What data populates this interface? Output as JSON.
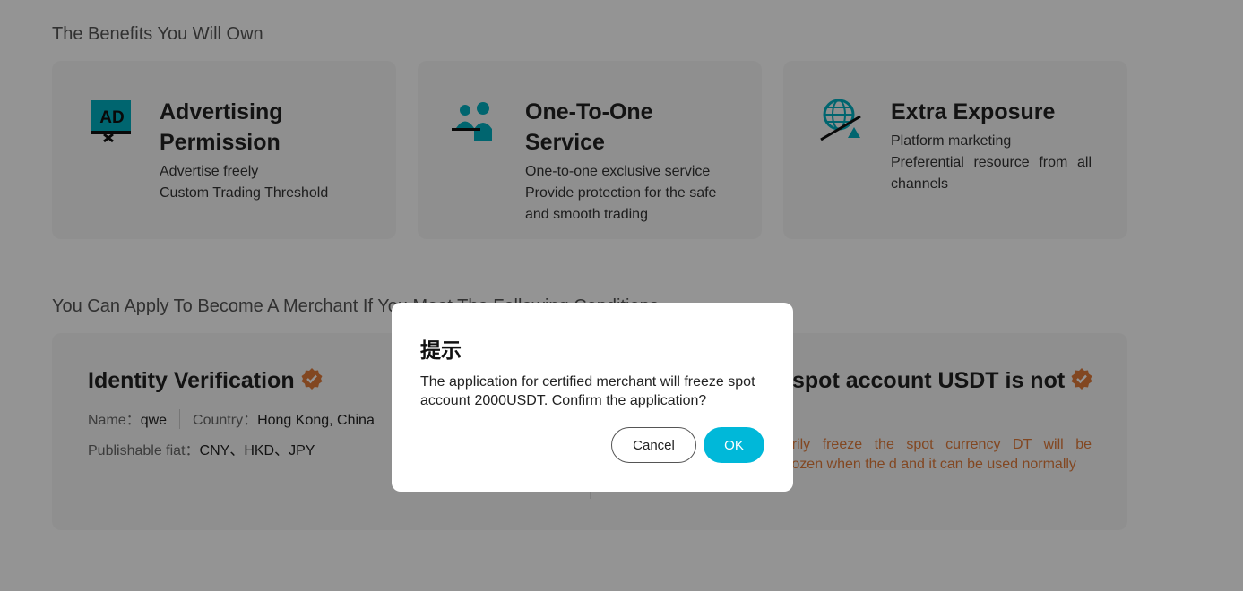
{
  "benefits": {
    "title": "The Benefits You Will Own",
    "cards": [
      {
        "icon": "ad-icon",
        "title_line1": "Advertising",
        "title_line2": "Permission",
        "desc": [
          "Advertise freely",
          "Custom Trading Threshold"
        ]
      },
      {
        "icon": "people-service-icon",
        "title_line1": "One-To-One",
        "title_line2": "Service",
        "desc": [
          "One-to-one exclusive service",
          "Provide protection for the safe and smooth trading"
        ]
      },
      {
        "icon": "globe-exposure-icon",
        "title_line1": "Extra Exposure",
        "desc": [
          "Platform marketing",
          "Preferential resource from all channels"
        ]
      }
    ]
  },
  "conditions": {
    "title": "You Can Apply To Become A Merchant If You Meet The Following Conditions",
    "identity": {
      "title": "Identity Verification",
      "name_label": "Name：",
      "name_value": "qwe",
      "country_label": "Country：",
      "country_value": "Hong Kong, China",
      "fiat_label": "Publishable fiat：",
      "fiat_value": "CNY、HKD、JPY"
    },
    "balance": {
      "title": "spot account USDT is not",
      "note": "on will temporarily freeze the spot currency DT will be automatically unfrozen when the d and it can be used normally"
    }
  },
  "dialog": {
    "title": "提示",
    "message": "The application for certified merchant will freeze spot account 2000USDT. Confirm the application?",
    "cancel_label": "Cancel",
    "ok_label": "OK"
  },
  "colors": {
    "accent": "#00b8d9",
    "badge": "#e07a3a",
    "warning": "#e07a3a"
  }
}
